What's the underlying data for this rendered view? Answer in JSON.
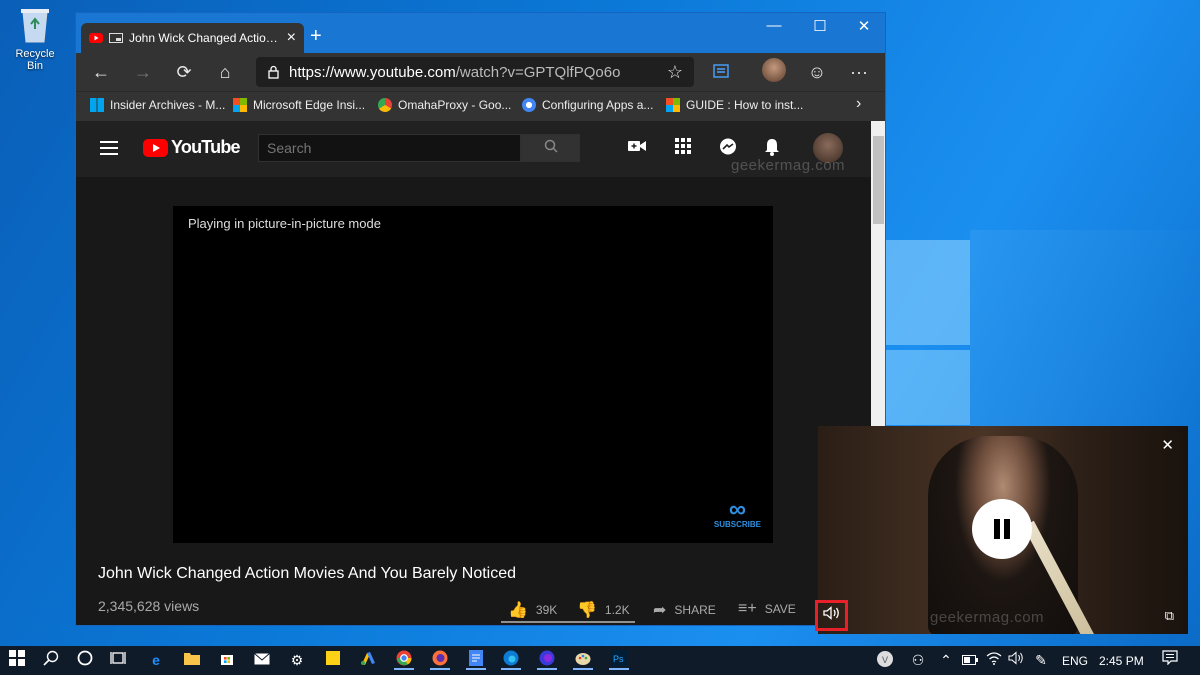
{
  "desktop": {
    "recycle_bin_label": "Recycle Bin"
  },
  "browser": {
    "tab_title": "John Wick Changed Action Movies And You Barely Noticed",
    "tab_close": "×",
    "new_tab": "+",
    "window_controls": {
      "minimize": "—",
      "maximize": "☐",
      "close": "✕"
    },
    "nav": {
      "back": "←",
      "forward": "→",
      "refresh": "⟳",
      "home": "⌂"
    },
    "url_main": "https://www.youtube.com",
    "url_rest": "/watch?v=GPTQlfPQo6o",
    "star": "☆",
    "more": "···",
    "bookmarks": [
      {
        "label": "Insider Archives - M...",
        "color": "#00a4ef"
      },
      {
        "label": "Microsoft Edge Insi...",
        "color": "#f25022"
      },
      {
        "label": "OmahaProxy - Goo...",
        "color": "#fbbc05"
      },
      {
        "label": "Configuring Apps a...",
        "color": "#4285f4"
      },
      {
        "label": "GUIDE : How to inst...",
        "color": "#f25022"
      }
    ],
    "bookmarks_more": "›"
  },
  "youtube": {
    "logo_text": "YouTube",
    "search_placeholder": "Search",
    "watermark": "geekermag.com",
    "player_message": "Playing in picture-in-picture mode",
    "brand_mark": "SUBSCRIBE",
    "video_title": "John Wick Changed Action Movies And You Barely Noticed",
    "views": "2,345,628 views",
    "likes": "39K",
    "dislikes": "1.2K",
    "share_label": "SHARE",
    "save_label": "SAVE"
  },
  "pip": {
    "close": "✕",
    "volume": "🔊",
    "popout": "⧉",
    "watermark": "geekermag.com"
  },
  "taskbar": {
    "language": "ENG",
    "time": "2:45 PM"
  }
}
